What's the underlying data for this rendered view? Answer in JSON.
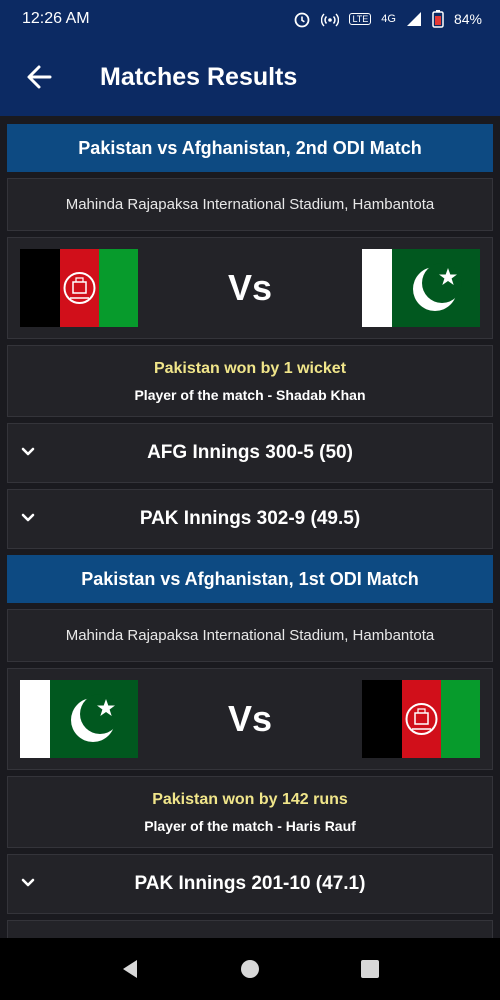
{
  "status_bar": {
    "time": "12:26 AM",
    "network": "4G",
    "volte": "LTE",
    "battery": "84%"
  },
  "app_bar": {
    "title": "Matches Results"
  },
  "matches": [
    {
      "title": "Pakistan vs Afghanistan, 2nd ODI Match",
      "venue": "Mahinda Rajapaksa International Stadium, Hambantota",
      "vs": "Vs",
      "left_team": "afghanistan",
      "right_team": "pakistan",
      "result": "Pakistan won by 1 wicket",
      "player_of_match": "Player of the match - Shadab Khan",
      "innings": [
        "AFG Innings 300-5 (50)",
        "PAK Innings 302-9 (49.5)"
      ]
    },
    {
      "title": "Pakistan vs Afghanistan, 1st ODI Match",
      "venue": "Mahinda Rajapaksa International Stadium, Hambantota",
      "vs": "Vs",
      "left_team": "pakistan",
      "right_team": "afghanistan",
      "result": "Pakistan won by 142 runs",
      "player_of_match": "Player of the match - Haris Rauf",
      "innings": [
        "PAK Innings 201-10 (47.1)"
      ]
    }
  ],
  "colors": {
    "app_bar": "#0c2a63",
    "match_header": "#0d4a82",
    "card": "#232328",
    "result": "#f0e58a",
    "pakistan_green": "#01581f",
    "afghan_red": "#d10f1a",
    "afghan_green": "#079b2c"
  },
  "icons": {
    "back": "arrow-left-icon",
    "expand": "chevron-down-icon",
    "nav_back": "triangle-back-icon",
    "nav_home": "circle-home-icon",
    "nav_recents": "square-recents-icon"
  }
}
